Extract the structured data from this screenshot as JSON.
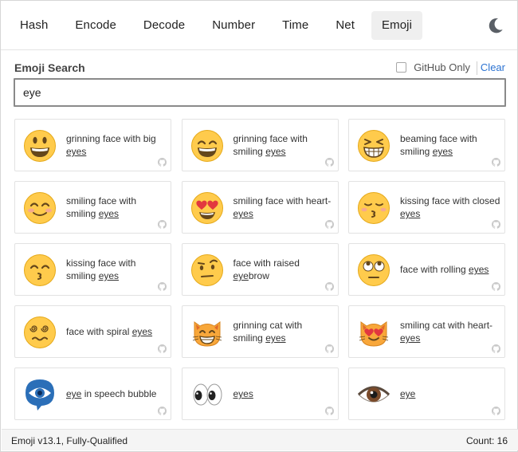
{
  "nav": {
    "tabs": [
      {
        "label": "Hash",
        "active": false
      },
      {
        "label": "Encode",
        "active": false
      },
      {
        "label": "Decode",
        "active": false
      },
      {
        "label": "Number",
        "active": false
      },
      {
        "label": "Time",
        "active": false
      },
      {
        "label": "Net",
        "active": false
      },
      {
        "label": "Emoji",
        "active": true
      }
    ],
    "theme_icon": "moon-icon"
  },
  "search": {
    "title": "Emoji Search",
    "github_only_label": "GitHub Only",
    "github_only_checked": false,
    "clear_label": "Clear",
    "query": "eye"
  },
  "results": [
    {
      "pre": "grinning face with big ",
      "match": "eyes",
      "post": "",
      "icon": "grinning-face-with-big-eyes"
    },
    {
      "pre": "grinning face with smiling ",
      "match": "eyes",
      "post": "",
      "icon": "grinning-face-with-smiling-eyes"
    },
    {
      "pre": "beaming face with smiling ",
      "match": "eyes",
      "post": "",
      "icon": "beaming-face-with-smiling-eyes"
    },
    {
      "pre": "smiling face with smiling ",
      "match": "eyes",
      "post": "",
      "icon": "smiling-face-with-smiling-eyes"
    },
    {
      "pre": "smiling face with heart-",
      "match": "eyes",
      "post": "",
      "icon": "smiling-face-with-heart-eyes"
    },
    {
      "pre": "kissing face with closed ",
      "match": "eyes",
      "post": "",
      "icon": "kissing-face-with-closed-eyes"
    },
    {
      "pre": "kissing face with smiling ",
      "match": "eyes",
      "post": "",
      "icon": "kissing-face-with-smiling-eyes"
    },
    {
      "pre": "face with raised ",
      "match": "eye",
      "post": "brow",
      "icon": "face-with-raised-eyebrow"
    },
    {
      "pre": "face with rolling ",
      "match": "eyes",
      "post": "",
      "icon": "face-with-rolling-eyes"
    },
    {
      "pre": "face with spiral ",
      "match": "eyes",
      "post": "",
      "icon": "face-with-spiral-eyes"
    },
    {
      "pre": "grinning cat with smiling ",
      "match": "eyes",
      "post": "",
      "icon": "grinning-cat-with-smiling-eyes"
    },
    {
      "pre": "smiling cat with heart-",
      "match": "eyes",
      "post": "",
      "icon": "smiling-cat-with-heart-eyes"
    },
    {
      "pre": "",
      "match": "eye",
      "post": " in speech bubble",
      "icon": "eye-in-speech-bubble"
    },
    {
      "pre": "",
      "match": "eyes",
      "post": "",
      "icon": "eyes"
    },
    {
      "pre": "",
      "match": "eye",
      "post": "",
      "icon": "eye"
    }
  ],
  "footer": {
    "version": "Emoji v13.1, Fully-Qualified",
    "count": "Count: 16"
  },
  "colors": {
    "face_yellow": "#ffcb4c",
    "face_outline": "#e5a91a",
    "feature_dark": "#65471b",
    "heart_red": "#e2373f",
    "cat_orange": "#f8a73a",
    "link_blue": "#2c73d2",
    "active_tab_bg": "#efefef",
    "search_border": "#8a8a8a"
  }
}
